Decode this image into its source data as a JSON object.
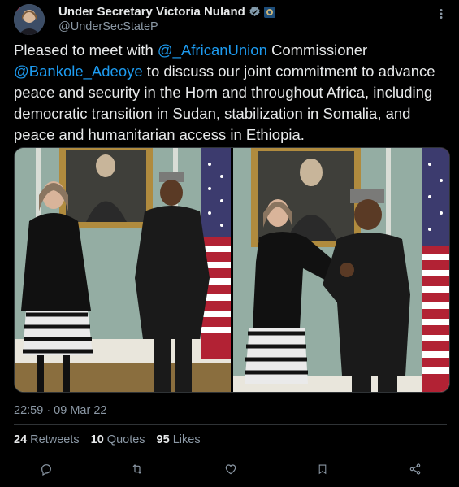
{
  "author": {
    "display_name": "Under Secretary Victoria Nuland",
    "handle": "@UnderSecStateP"
  },
  "tweet": {
    "segments": [
      {
        "type": "text",
        "text": "Pleased to meet with "
      },
      {
        "type": "mention",
        "text": "@_AfricanUnion"
      },
      {
        "type": "text",
        "text": " Commissioner "
      },
      {
        "type": "mention",
        "text": "@Bankole_Adeoye"
      },
      {
        "type": "text",
        "text": " to discuss our joint commitment to advance peace and security in the Horn and throughout Africa, including democratic transition in Sudan, stabilization in Somalia, and peace and humanitarian access in Ethiopia."
      }
    ]
  },
  "timestamp": "22:59 · 09 Mar 22",
  "stats": {
    "retweets": {
      "count": "24",
      "label": "Retweets"
    },
    "quotes": {
      "count": "10",
      "label": "Quotes"
    },
    "likes": {
      "count": "95",
      "label": "Likes"
    }
  },
  "actions": [
    "reply-icon",
    "retweet-icon",
    "like-icon",
    "bookmark-icon",
    "share-icon"
  ],
  "colors": {
    "background": "#000000",
    "text": "#e7e9ea",
    "secondary": "#8b98a5",
    "accent": "#1d9bf0",
    "divider": "#2f3336"
  }
}
